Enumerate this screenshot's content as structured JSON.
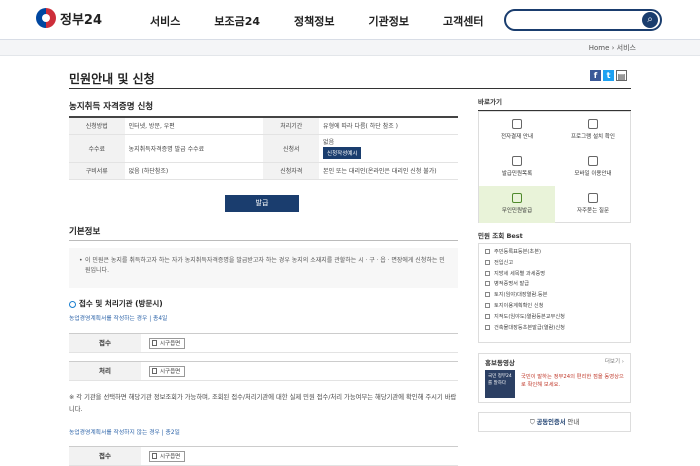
{
  "header": {
    "logo_text": "정부24",
    "nav": [
      "서비스",
      "보조금24",
      "정책정보",
      "기관정보",
      "고객센터"
    ],
    "search_placeholder": ""
  },
  "breadcrumb": "Home › 서비스",
  "page_title": "민원안내 및 신청",
  "service": {
    "title": "농지취득 자격증명 신청",
    "rows": [
      {
        "h1": "신청방법",
        "v1": "인터넷, 방문, 우편",
        "h2": "처리기간",
        "v2": "유형에 따라 다름( 하단 참조 )"
      },
      {
        "h1": "수수료",
        "v1": "농지취득자격증명 발급 수수료",
        "h2": "신청서",
        "v2": "없음",
        "btn": "신청작성예시"
      },
      {
        "h1": "구비서류",
        "v1": "없음 (하단참조)",
        "h2": "신청자격",
        "v2": "본인 또는 대리인(온라인은 대리인 신청 불가)"
      }
    ],
    "issue_button": "발급"
  },
  "basic": {
    "title": "기본정보",
    "text": "이 민원은 농지를 취득하고자 하는 자가 농지취득자격증명을 발급받고자 하는 경우 농지의 소재지를 관할하는 시ㆍ구ㆍ읍ㆍ면장에게 신청하는 민원입니다."
  },
  "reception": {
    "title": "접수 및 처리기관 (방문시)",
    "case1": "농업경영계획서를 작성하는 경우 | 총4일",
    "row1_label": "접수",
    "row2_label": "처리",
    "office_label": "시구읍면",
    "note": "※ 각 기관을 선택하면 해당기관 정보조회가 가능하며, 조회된 접수/처리기관에 대한 실제 민원 접수/처리 가능여부는 해당기관에 확인해 주시기 바랍니다.",
    "case2": "농업경영계획서를 작성하지 않는 경우 | 총2일",
    "row3_label": "접수"
  },
  "sidebar": {
    "quick_title": "바로가기",
    "quick": [
      "전자결재 안내",
      "프로그램 설치 확인",
      "발급민원목록",
      "모바일 이용안내",
      "무인민원발급",
      "자주묻는 질문"
    ],
    "best_title": "민원 조회 Best",
    "best": [
      "주민등록표등본(초본)",
      "전입신고",
      "지방세 세목별 과세증명",
      "병적증명서 발급",
      "토지(임야)대장열람.등본",
      "토지이용계획확인 신청",
      "지적도(임야도)열람등본교부신청",
      "건축물대장등초본발급(열람)신청"
    ],
    "promo_title": "홍보동영상",
    "promo_more": "더보기 ›",
    "promo_img": "국민 정부24를 말하다",
    "promo_text": "국민이 말하는 정부24의 편리한 점을 동영상으로 확인해 보세요.",
    "cert_bold": "공동인증서",
    "cert_rest": " 안내"
  }
}
